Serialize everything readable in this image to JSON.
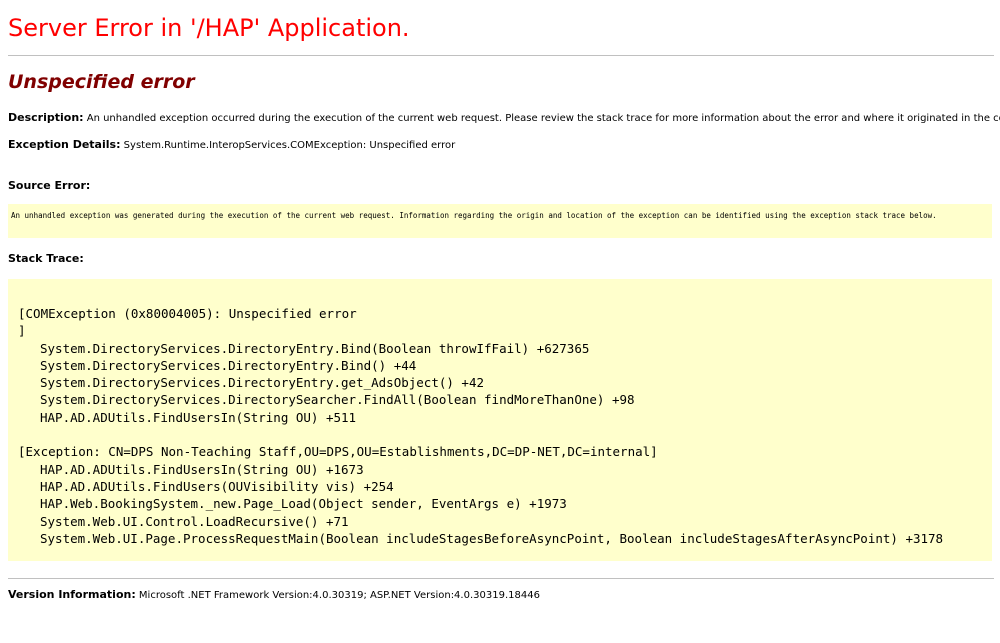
{
  "page_title": "Server Error in '/HAP' Application.",
  "error_heading": "Unspecified error",
  "description": {
    "label": "Description:",
    "text": "An unhandled exception occurred during the execution of the current web request. Please review the stack trace for more information about the error and where it originated in the code."
  },
  "exception_details": {
    "label": "Exception Details:",
    "text": "System.Runtime.InteropServices.COMException: Unspecified error"
  },
  "source_error": {
    "label": "Source Error:",
    "text": "An unhandled exception was generated during the execution of the current web request. Information regarding the origin and location of the exception can be identified using the exception stack trace below."
  },
  "stack_trace": {
    "label": "Stack Trace:",
    "lines": [
      "[COMException (0x80004005): Unspecified error",
      "]",
      "System.DirectoryServices.DirectoryEntry.Bind(Boolean throwIfFail) +627365",
      "System.DirectoryServices.DirectoryEntry.Bind() +44",
      "System.DirectoryServices.DirectoryEntry.get_AdsObject() +42",
      "System.DirectoryServices.DirectorySearcher.FindAll(Boolean findMoreThanOne) +98",
      "HAP.AD.ADUtils.FindUsersIn(String OU) +511",
      "[Exception: CN=DPS Non-Teaching Staff,OU=DPS,OU=Establishments,DC=DP-NET,DC=internal]",
      "HAP.AD.ADUtils.FindUsersIn(String OU) +1673",
      "HAP.AD.ADUtils.FindUsers(OUVisibility vis) +254",
      "HAP.Web.BookingSystem._new.Page_Load(Object sender, EventArgs e) +1973",
      "System.Web.UI.Control.LoadRecursive() +71",
      "System.Web.UI.Page.ProcessRequestMain(Boolean includeStagesBeforeAsyncPoint, Boolean includeStagesAfterAsyncPoint) +3178"
    ]
  },
  "version_info": {
    "label": "Version Information:",
    "text": "Microsoft .NET Framework Version:4.0.30319; ASP.NET Version:4.0.30319.18446"
  },
  "colors": {
    "title": "#ff0000",
    "heading": "#800000",
    "code_background": "#ffffcc",
    "rule": "#c0c0c0"
  }
}
